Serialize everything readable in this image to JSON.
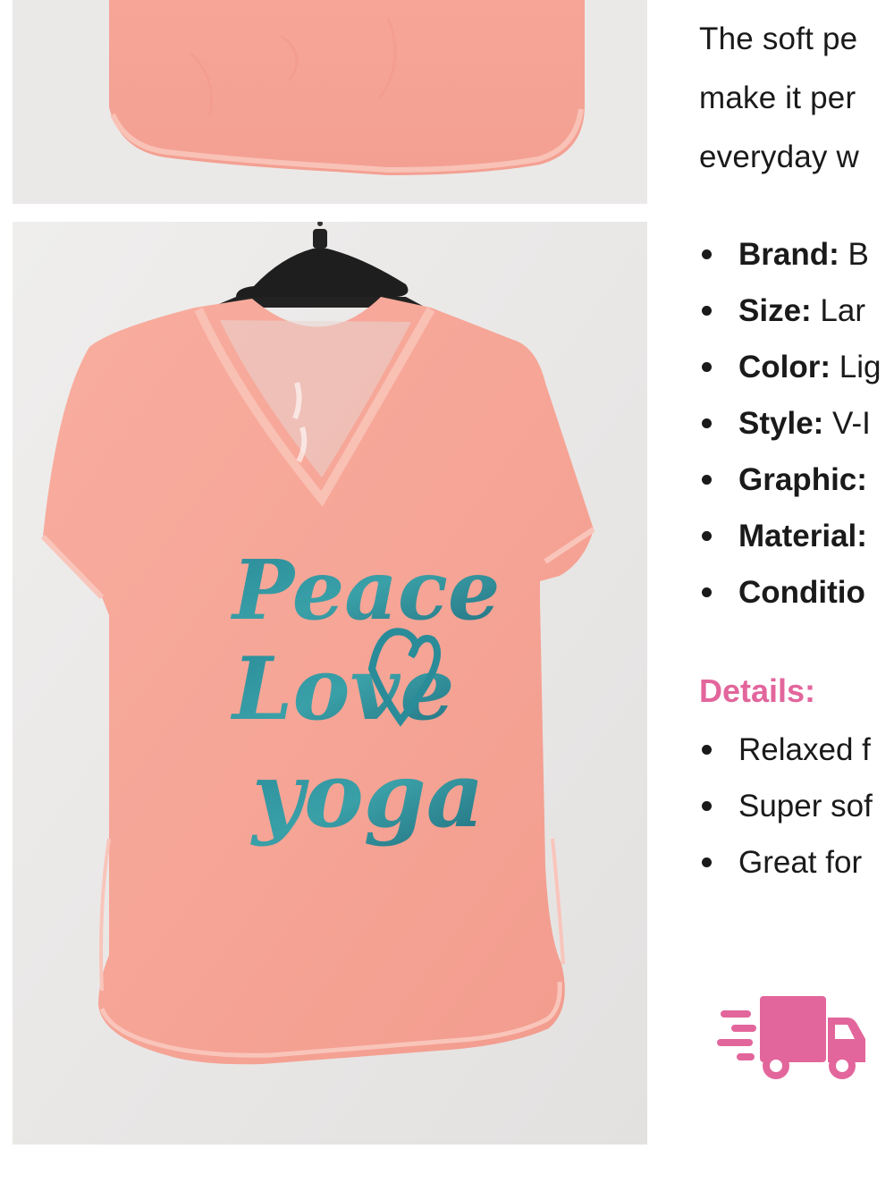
{
  "description": {
    "line_top": "",
    "line1": "The soft pe",
    "line2": "make it per",
    "line3": "everyday w"
  },
  "specs": [
    {
      "key": "Brand:",
      "value": " B"
    },
    {
      "key": "Size:",
      "value": " Lar"
    },
    {
      "key": "Color:",
      "value": " Lig"
    },
    {
      "key": "Style:",
      "value": " V-I"
    },
    {
      "key": "Graphic:",
      "value": ""
    },
    {
      "key": "Material:",
      "value": ""
    },
    {
      "key": "Conditio",
      "value": ""
    }
  ],
  "details": {
    "heading": "Details:",
    "items": [
      "Relaxed f",
      "Super sof",
      "Great for"
    ]
  },
  "graphic_text": {
    "word1": "Peace",
    "word2": "Love",
    "word3": "yoga"
  },
  "colors": {
    "accent_pink": "#e2669c",
    "shirt": "#f7a79a",
    "graphic_teal": "#2a8c98",
    "backdrop": "#ebe9e8"
  },
  "icons": [
    "delivery-truck-icon",
    "hanger-icon"
  ]
}
